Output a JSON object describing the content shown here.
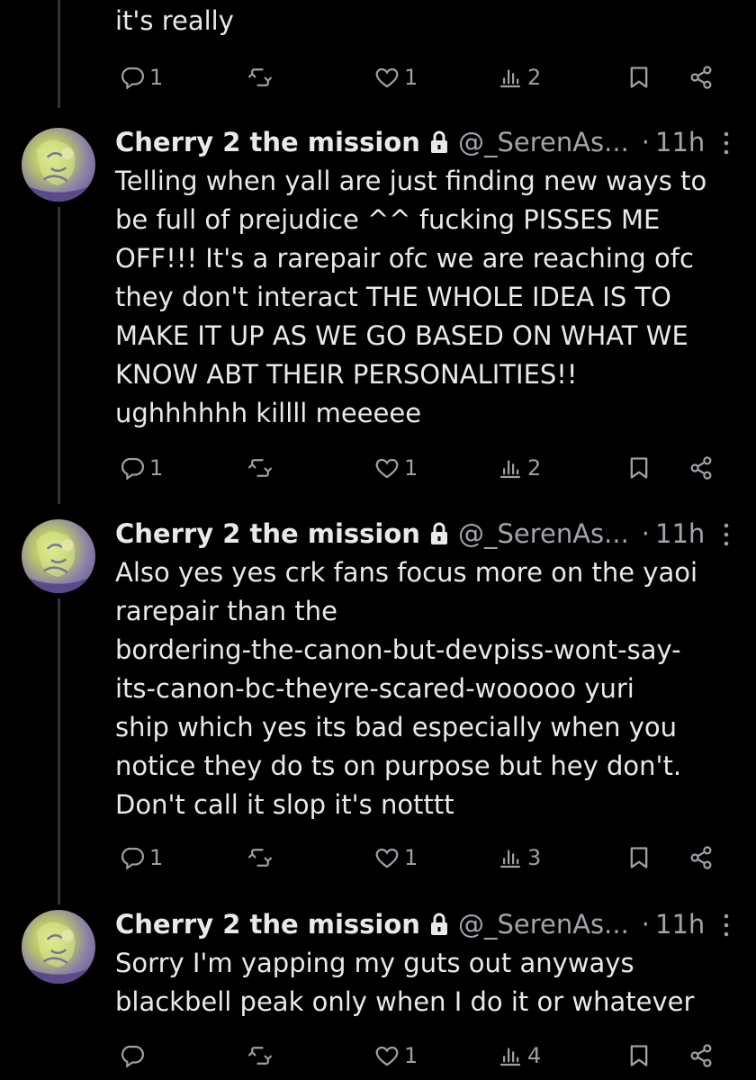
{
  "author": {
    "name": "Cherry 2 the mission",
    "handle": "@_SerenAs...",
    "time": "11h"
  },
  "separator": "·",
  "top_fragment": {
    "text": "it's really",
    "replies": "1",
    "reposts": "",
    "likes": "1",
    "views": "2"
  },
  "tweets": [
    {
      "text": "Telling when yall are just finding new ways to\nbe full of prejudice ^^ fucking PISSES ME\nOFF!!! It's a rarepair ofc we are reaching ofc\nthey don't interact THE WHOLE IDEA IS TO\nMAKE IT UP AS WE GO BASED ON WHAT WE\nKNOW ABT THEIR PERSONALITIES!!\nughhhhhh killll meeeee",
      "replies": "1",
      "reposts": "",
      "likes": "1",
      "views": "2"
    },
    {
      "text": "Also yes yes crk fans focus more on the yaoi\nrarepair than the\nbordering-the-canon-but-devpiss-wont-say-\nits-canon-bc-theyre-scared-wooooo yuri\nship which yes its bad especially when you\nnotice they do ts on purpose but hey don't.\nDon't call it slop it's notttt",
      "replies": "1",
      "reposts": "",
      "likes": "1",
      "views": "3"
    },
    {
      "text": "Sorry I'm yapping my guts out anyways\nblackbell peak only when I do it or whatever",
      "replies": "",
      "reposts": "",
      "likes": "1",
      "views": "4"
    }
  ],
  "icons": {
    "reply": "reply-icon",
    "repost": "repost-icon",
    "like": "heart-icon",
    "views": "views-icon",
    "bookmark": "bookmark-icon",
    "share": "share-icon",
    "lock": "lock-icon",
    "more": "more-icon"
  },
  "colors": {
    "background": "#000000",
    "text": "#e7e9ea",
    "secondary": "#a0a5aa",
    "thread_line": "#333639"
  }
}
